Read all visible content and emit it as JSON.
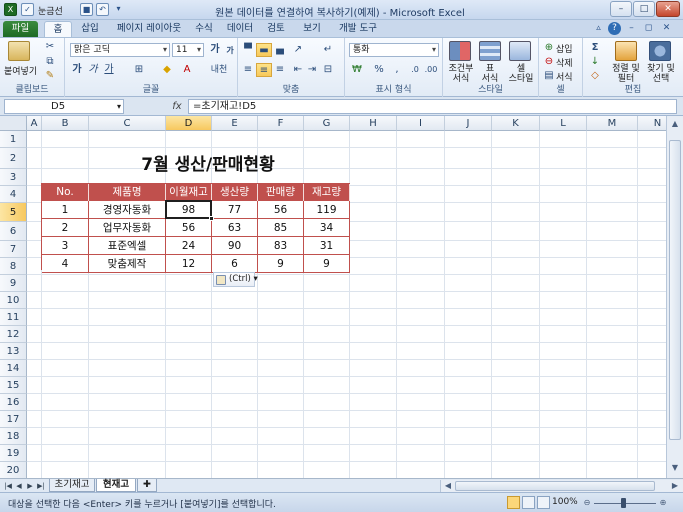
{
  "app": {
    "title": "원본 데이터를 연결하여 복사하기(예제) - Microsoft Excel",
    "qat_label": "눈금선",
    "window_buttons": [
      "–",
      "□",
      "✕"
    ]
  },
  "ribbon_tabs": [
    "파일",
    "홈",
    "삽입",
    "페이지 레이아웃",
    "수식",
    "데이터",
    "검토",
    "보기",
    "개발 도구"
  ],
  "ribbon": {
    "clipboard": {
      "paste": "붙여넣기",
      "label": "클립보드"
    },
    "font": {
      "name": "맑은 고딕",
      "size": "11",
      "grow": "가",
      "shrink": "가",
      "bold": "가",
      "italic": "가",
      "underline": "가",
      "ruby": "내천",
      "label": "글꼴"
    },
    "alignment": {
      "label": "맞춤"
    },
    "number": {
      "format": "통화",
      "percent": "%",
      "comma": ",",
      "label": "표시 형식"
    },
    "styles": {
      "conditional": "조건부\n서식",
      "table": "표\n서식",
      "cell": "셀\n스타일",
      "label": "스타일"
    },
    "cells": {
      "insert": "삽입",
      "delete": "삭제",
      "format": "서식",
      "label": "셀"
    },
    "editing": {
      "sum": "Σ",
      "sort": "정렬 및\n필터",
      "find": "찾기 및\n선택",
      "label": "편집"
    }
  },
  "formula_bar": {
    "name_box": "D5",
    "fx": "fx",
    "formula": "=초기재고!D5"
  },
  "columns": [
    "A",
    "B",
    "C",
    "D",
    "E",
    "F",
    "G",
    "H",
    "I",
    "J",
    "K",
    "L",
    "M",
    "N"
  ],
  "rows": [
    "1",
    "2",
    "3",
    "4",
    "5",
    "6",
    "7",
    "8",
    "9",
    "10",
    "11",
    "12",
    "13",
    "14",
    "15",
    "16",
    "17",
    "18",
    "19",
    "20"
  ],
  "sheet": {
    "title": "7월 생산/판매현황",
    "headers": [
      "No.",
      "제품명",
      "이월재고",
      "생산량",
      "판매량",
      "재고량"
    ],
    "data": [
      [
        "1",
        "경영자동화",
        "98",
        "77",
        "56",
        "119"
      ],
      [
        "2",
        "업무자동화",
        "56",
        "63",
        "85",
        "34"
      ],
      [
        "3",
        "표준엑셀",
        "24",
        "90",
        "83",
        "31"
      ],
      [
        "4",
        "맞춤제작",
        "12",
        "6",
        "9",
        "9"
      ]
    ],
    "paste_options": "(Ctrl)"
  },
  "sheet_tabs": [
    "초기재고",
    "현재고"
  ],
  "status": {
    "message": "대상을 선택한 다음 <Enter> 키를 누르거나 [붙여넣기]를 선택합니다.",
    "zoom": "100%"
  },
  "colors": {
    "header_fill": "#c0504d",
    "accent": "#1e6a24"
  }
}
